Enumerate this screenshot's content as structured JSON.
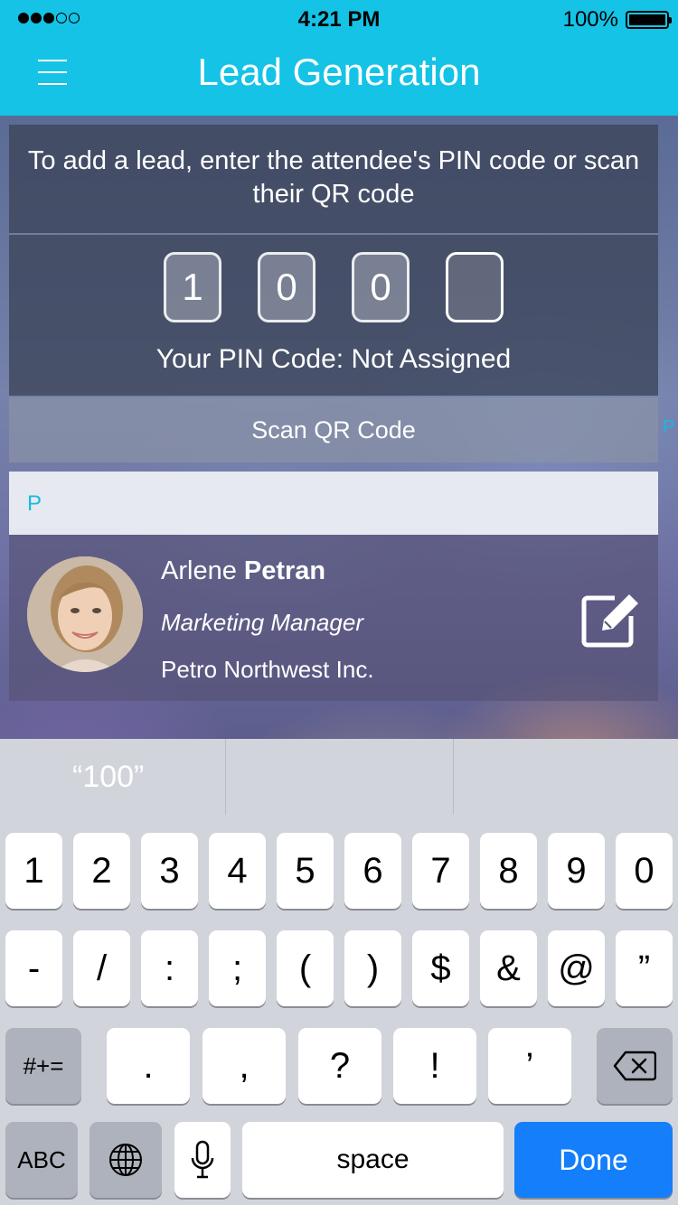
{
  "status_bar": {
    "time": "4:21 PM",
    "battery_percent": "100%",
    "signal_strength": 3,
    "signal_max": 5
  },
  "header": {
    "title": "Lead Generation",
    "menu_icon": "hamburger-menu-icon"
  },
  "pin_entry": {
    "instruction": "To add a lead, enter the attendee's PIN code or scan their QR code",
    "digits": [
      "1",
      "0",
      "0",
      ""
    ],
    "your_pin_label": "Your PIN Code: Not Assigned"
  },
  "scan_button": {
    "label": "Scan QR Code"
  },
  "index_letter": "P",
  "section_header": "P",
  "lead": {
    "first_name": "Arlene",
    "last_name": "Petran",
    "title": "Marketing Manager",
    "company": "Petro Northwest Inc.",
    "edit_icon": "edit-icon"
  },
  "keyboard": {
    "suggestions": [
      "“100”",
      "",
      ""
    ],
    "row1": [
      "1",
      "2",
      "3",
      "4",
      "5",
      "6",
      "7",
      "8",
      "9",
      "0"
    ],
    "row2": [
      "-",
      "/",
      ":",
      ";",
      "(",
      ")",
      "$",
      "&",
      "@",
      "”"
    ],
    "row3_mode": "#+=",
    "row3": [
      ".",
      ",",
      "?",
      "!",
      "’"
    ],
    "backspace_icon": "backspace-icon",
    "abc_label": "ABC",
    "globe_icon": "globe-icon",
    "mic_icon": "microphone-icon",
    "space_label": "space",
    "done_label": "Done"
  },
  "colors": {
    "header": "#14c3e6",
    "accent": "#19b9e0",
    "done_key": "#147efb"
  }
}
